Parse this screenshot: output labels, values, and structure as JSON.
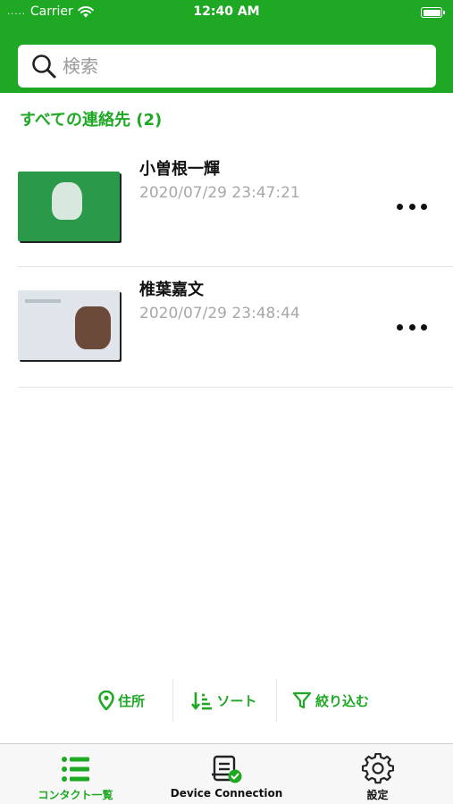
{
  "status_bar": {
    "carrier": "Carrier",
    "time": "12:40 AM",
    "signal": "....."
  },
  "search": {
    "placeholder": "検索",
    "value": ""
  },
  "contacts": {
    "header": "すべての連絡先 (2)",
    "items": [
      {
        "name": "小曽根一輝",
        "timestamp": "2020/07/29 23:47:21"
      },
      {
        "name": "椎葉嘉文",
        "timestamp": "2020/07/29 23:48:44"
      }
    ]
  },
  "filter_bar": {
    "address_label": "住所",
    "sort_label": "ソート",
    "narrow_label": "絞り込む"
  },
  "tab_bar": {
    "tabs": [
      {
        "label": "コンタクト一覧",
        "icon": "list-icon",
        "selected": true
      },
      {
        "label": "Device Connection",
        "icon": "device-connection-icon",
        "selected": false
      },
      {
        "label": "設定",
        "icon": "gear-icon",
        "selected": false
      }
    ]
  },
  "colors": {
    "brand_green": "#1fa824",
    "timestamp_gray": "#a8a8a8"
  }
}
